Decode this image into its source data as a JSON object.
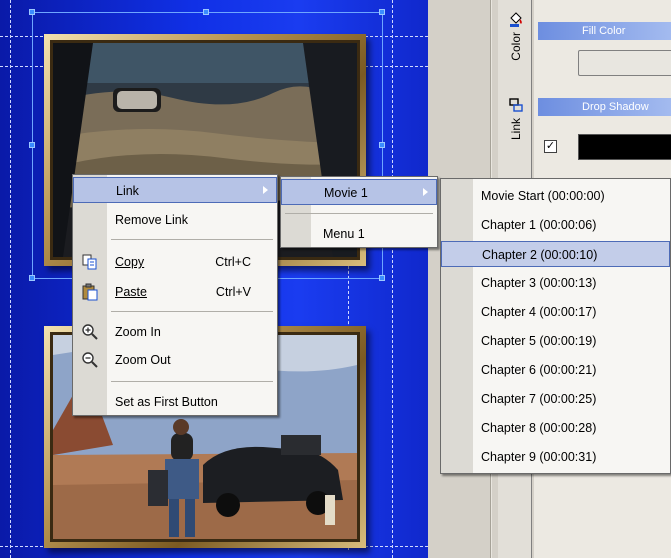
{
  "context_menu": {
    "link_label": "Link",
    "remove_link_label": "Remove Link",
    "copy_label": "Copy",
    "copy_shortcut": "Ctrl+C",
    "paste_label": "Paste",
    "paste_shortcut": "Ctrl+V",
    "zoom_in_label": "Zoom In",
    "zoom_out_label": "Zoom Out",
    "set_first_label": "Set as First Button"
  },
  "link_submenu": {
    "movie_label": "Movie 1",
    "menu_label": "Menu 1"
  },
  "chapters": [
    "Movie Start (00:00:00)",
    "Chapter 1 (00:00:06)",
    "Chapter 2 (00:00:10)",
    "Chapter 3 (00:00:13)",
    "Chapter 4 (00:00:17)",
    "Chapter 5 (00:00:19)",
    "Chapter 6 (00:00:21)",
    "Chapter 7 (00:00:25)",
    "Chapter 8 (00:00:28)",
    "Chapter 9 (00:00:31)"
  ],
  "highlighted_chapter_index": 2,
  "panel": {
    "color_tab": "Color",
    "link_tab": "Link",
    "fill_color_header": "Fill Color",
    "drop_shadow_header": "Drop Shadow",
    "drop_shadow_checked": true
  },
  "colors": {
    "canvas_blue": "#1030e6",
    "menu_highlight": "#b6c3e6",
    "menu_highlight_border": "#4d6bb7",
    "panel_header": "#6d8ee0"
  }
}
